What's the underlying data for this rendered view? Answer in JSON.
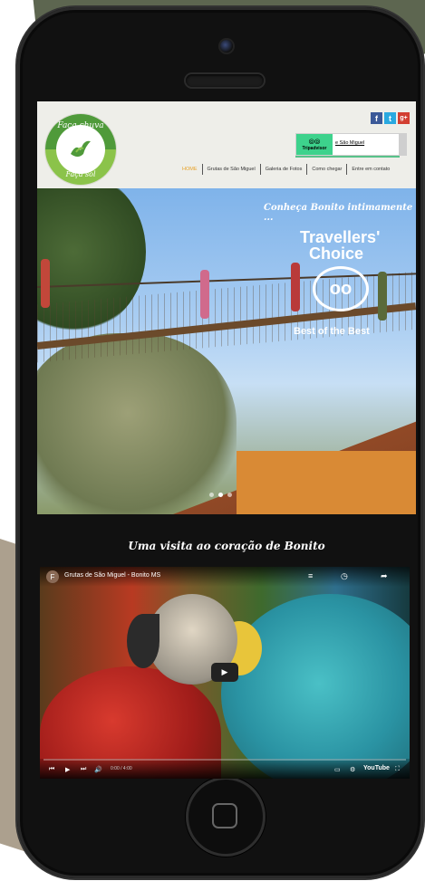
{
  "logo": {
    "top_text": "Faça chuva",
    "bottom_text": "Faça sol"
  },
  "social": {
    "facebook": "f",
    "twitter": "t",
    "googleplus": "g+"
  },
  "tripadvisor": {
    "owl": "⦾⦾",
    "brand": "Tripadvisor",
    "link": "e São Miguel"
  },
  "nav": {
    "items": [
      "HOME",
      "Grutas de São Miguel",
      "Galeria de Fotos",
      "Como chegar",
      "Entre em contato"
    ]
  },
  "hero": {
    "tagline": "Conheça Bonito intimamente ...",
    "award_line1": "Travellers'",
    "award_line2": "Choice",
    "award_owl": "oo",
    "award_best": "Best of the Best"
  },
  "section": {
    "title": "Uma visita ao coração de Bonito"
  },
  "video": {
    "channel_initial": "F",
    "title": "Grutas de São Miguel - Bonito MS",
    "time": "0:00 / 4:00",
    "brand": "YouTube",
    "progress": 0
  },
  "colors": {
    "header_bg": "#eeeee9",
    "nav_active": "#e8a227",
    "tripadvisor_green": "#3dd28c",
    "logo_green": "#4f9a3a"
  }
}
